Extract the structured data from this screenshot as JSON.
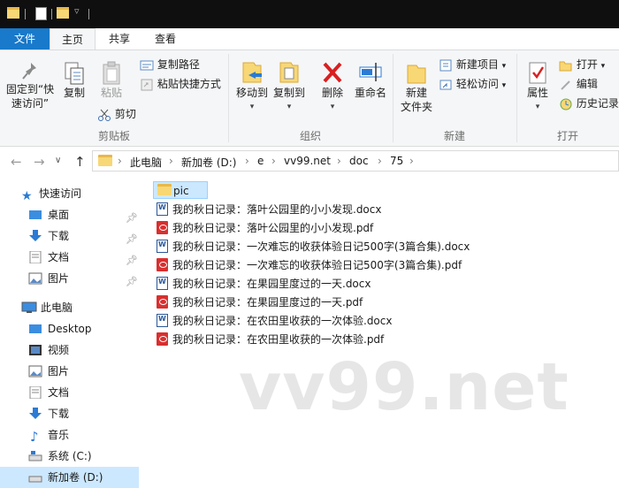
{
  "ribbon_tabs": {
    "file": "文件",
    "home": "主页",
    "share": "共享",
    "view": "查看"
  },
  "clipboard": {
    "pin": "固定到“快速访问”",
    "pin_l1": "固定到“快",
    "pin_l2": "速访问”",
    "copy": "复制",
    "paste": "粘贴",
    "copy_path": "复制路径",
    "paste_shortcut": "粘贴快捷方式",
    "cut": "剪切",
    "group": "剪贴板"
  },
  "organize": {
    "move_to": "移动到",
    "copy_to": "复制到",
    "delete": "删除",
    "rename": "重命名",
    "group": "组织"
  },
  "new_group": {
    "new_folder_l1": "新建",
    "new_folder_l2": "文件夹",
    "new_item": "新建项目",
    "easy_access": "轻松访问",
    "group": "新建"
  },
  "open_group": {
    "properties": "属性",
    "open": "打开",
    "edit": "编辑",
    "history": "历史记录",
    "group": "打开"
  },
  "breadcrumb": [
    "此电脑",
    "新加卷 (D:)",
    "e",
    "vv99.net",
    "doc",
    "75"
  ],
  "nav": {
    "quick_access": "快速访问",
    "quick_items": [
      "桌面",
      "下载",
      "文档",
      "图片"
    ],
    "this_pc": "此电脑",
    "pc_items": [
      "Desktop",
      "视频",
      "图片",
      "文档",
      "下载",
      "音乐",
      "系统 (C:)",
      "新加卷 (D:)"
    ]
  },
  "files": [
    {
      "name": "pic",
      "type": "folder"
    },
    {
      "name": "我的秋日记录：落叶公园里的小小发现.docx",
      "type": "docx"
    },
    {
      "name": "我的秋日记录：落叶公园里的小小发现.pdf",
      "type": "pdf"
    },
    {
      "name": "我的秋日记录：一次难忘的收获体验日记500字(3篇合集).docx",
      "type": "docx"
    },
    {
      "name": "我的秋日记录：一次难忘的收获体验日记500字(3篇合集).pdf",
      "type": "pdf"
    },
    {
      "name": "我的秋日记录：在果园里度过的一天.docx",
      "type": "docx"
    },
    {
      "name": "我的秋日记录：在果园里度过的一天.pdf",
      "type": "pdf"
    },
    {
      "name": "我的秋日记录：在农田里收获的一次体验.docx",
      "type": "docx"
    },
    {
      "name": "我的秋日记录：在农田里收获的一次体验.pdf",
      "type": "pdf"
    }
  ],
  "watermark": "vv99.net",
  "colors": {
    "accent": "#1979ca",
    "selection": "#cce8ff",
    "titlebar": "#0f0f0f"
  }
}
